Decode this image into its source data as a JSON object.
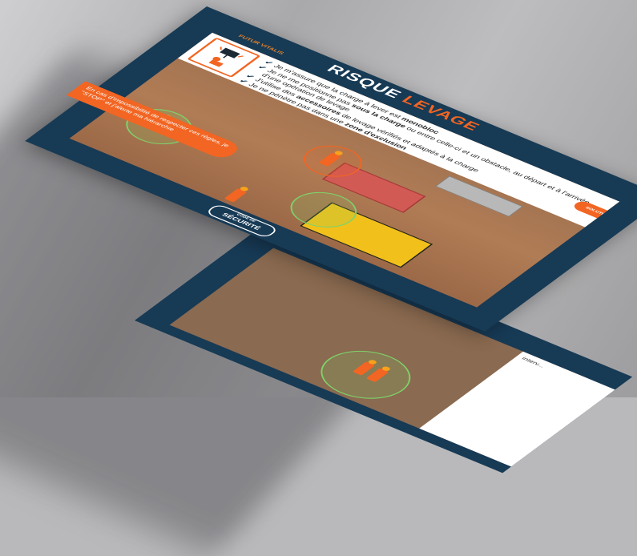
{
  "brand": {
    "name": "FUTUR VITALIS"
  },
  "title": {
    "part1": "RISQUE",
    "part2": "LEVAGE"
  },
  "rules": [
    {
      "pre": "Je m'assure que la charge à lever est ",
      "bold": "monobloc",
      "post": ""
    },
    {
      "pre": "Je ne me positionne pas ",
      "bold": "sous la charge",
      "post": " ou entre celle-ci et un obstacle, au départ et à l'arrivée d'une opération de levage"
    },
    {
      "pre": "J'utilise des ",
      "bold": "accessoires",
      "post": " de levage vérifiés et adaptés à la charge"
    },
    {
      "pre": "Je ne pénètre pas dans une ",
      "bold": "zone d'exclusion",
      "post": ""
    }
  ],
  "alert": {
    "text": "En cas d'impossibilité de respecter ces règles, je \"STOP\" et j'alerte ma hiérarchie"
  },
  "badge": {
    "text": "SOLUTIONS"
  },
  "footer": {
    "small": "CODE DE",
    "big": "SÉCURITÉ"
  },
  "second_slide": {
    "partial_text": "interv..."
  },
  "colors": {
    "navy": "#173a55",
    "accent": "#f26522",
    "safe": "#7ed36a"
  }
}
